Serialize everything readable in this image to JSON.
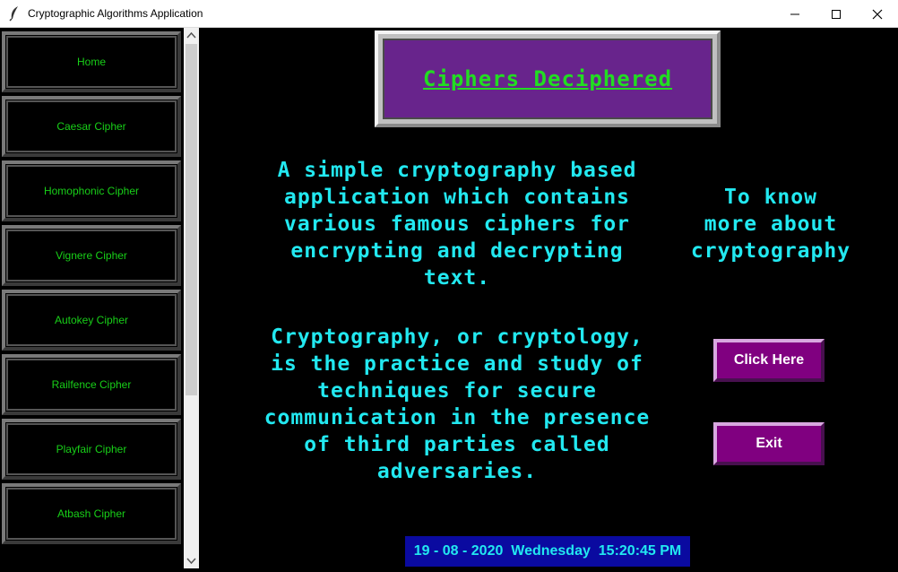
{
  "window": {
    "title": "Cryptographic Algorithms Application",
    "icon": "feather-icon"
  },
  "sidebar": {
    "items": [
      {
        "label": "Home"
      },
      {
        "label": "Caesar Cipher"
      },
      {
        "label": "Homophonic Cipher"
      },
      {
        "label": "Vignere Cipher"
      },
      {
        "label": "Autokey Cipher"
      },
      {
        "label": "Railfence Cipher"
      },
      {
        "label": "Playfair Cipher"
      },
      {
        "label": "Atbash Cipher"
      }
    ],
    "text_color": "#18d018"
  },
  "main": {
    "banner_title": "Ciphers Deciphered",
    "description": "A simple cryptography based\napplication which contains\nvarious famous ciphers for\nencrypting and decrypting\ntext.",
    "definition": "Cryptography, or cryptology,\nis the practice and study of\ntechniques for secure\ncommunication in the presence\nof third parties called\nadversaries.",
    "know_more": "To know\nmore about\ncryptography",
    "click_here_label": "Click Here",
    "exit_label": "Exit",
    "clock": "19 - 08 - 2020  Wednesday  15:20:45 PM"
  },
  "colors": {
    "banner_bg": "#68248c",
    "banner_text": "#22dd22",
    "cyan_text": "#22e8f0",
    "button_bg": "#800080",
    "clock_bg": "#0a0aa0"
  }
}
